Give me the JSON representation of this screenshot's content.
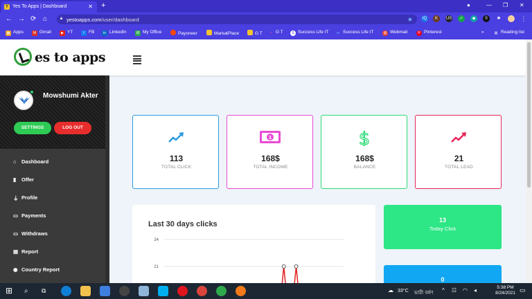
{
  "browser": {
    "tab_title": "Yes To Apps | Dashboard",
    "tab_favicon": "Y",
    "url_host": "yestoapps.com",
    "url_path": "/user/dashboard",
    "new_tab_glyph": "+",
    "bookmarks": [
      {
        "label": "Apps",
        "color": "#f0a030"
      },
      {
        "label": "Gmail",
        "color": "#d93025"
      },
      {
        "label": "YT",
        "color": "#e62117"
      },
      {
        "label": "FB",
        "color": "#1877f2"
      },
      {
        "label": "LinkedIn",
        "color": "#0a66c2"
      },
      {
        "label": "My Office",
        "color": "#2fa84f"
      },
      {
        "label": "Payoneer",
        "color": "#ff4800"
      },
      {
        "label": "MarkatPlace",
        "color": "#f4c430"
      },
      {
        "label": "G T",
        "color": "#f4c430"
      },
      {
        "label": "G T",
        "color": "#e83e8c"
      },
      {
        "label": "Success Life IT",
        "color": "#ffffff"
      },
      {
        "label": "Success Life IT",
        "color": "#6fb0ff"
      },
      {
        "label": "Webmail",
        "color": "#e8412c"
      },
      {
        "label": "Pinterest",
        "color": "#e60023"
      }
    ],
    "reading_list": "Reading list"
  },
  "header": {
    "logo_text": "es to apps"
  },
  "sidebar": {
    "user_name": "Mowshumi Akter",
    "settings_label": "SETTINGS",
    "logout_label": "LOG OUT",
    "items": [
      {
        "label": "Dashboard",
        "icon": "home-icon",
        "glyph": "⌂"
      },
      {
        "label": "Offer",
        "icon": "bookmark-icon",
        "glyph": "▮"
      },
      {
        "label": "Profile",
        "icon": "bank-icon",
        "glyph": "⏚"
      },
      {
        "label": "Payments",
        "icon": "money-icon",
        "glyph": "▭"
      },
      {
        "label": "Withdraws",
        "icon": "money-icon",
        "glyph": "▭"
      },
      {
        "label": "Report",
        "icon": "calendar-icon",
        "glyph": "▤"
      },
      {
        "label": "Country Report",
        "icon": "globe-icon",
        "glyph": "◉"
      }
    ]
  },
  "stats": [
    {
      "value": "113",
      "label": "TOTAL CLICK",
      "color": "#2b9be0"
    },
    {
      "value": "168$",
      "label": "TOTAL INCOME",
      "color": "#e94bd3"
    },
    {
      "value": "168$",
      "label": "BALANCE",
      "color": "#2ddc7a"
    },
    {
      "value": "21",
      "label": "TOTAL LEAD",
      "color": "#e8245a"
    }
  ],
  "chart_data": {
    "type": "line",
    "title": "Last 30 days clicks",
    "y_ticks": [
      24,
      21
    ],
    "points": [
      {
        "x": 20,
        "y": 21
      },
      {
        "x": 22,
        "y": 21
      }
    ],
    "color": "#e02020"
  },
  "today_click": {
    "value": "13",
    "label": "Today Click"
  },
  "blue_panel": {
    "value": "0"
  },
  "taskbar": {
    "weather": "33°C",
    "weather_text": "ভারী বর্ষণ",
    "time": "5:38 PM",
    "date": "8/24/2021"
  }
}
